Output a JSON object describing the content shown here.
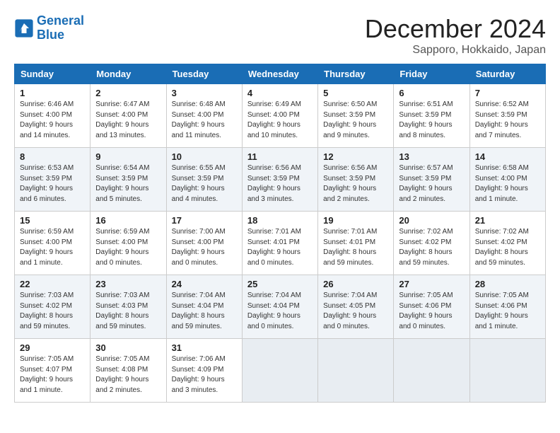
{
  "logo": {
    "line1": "General",
    "line2": "Blue"
  },
  "title": "December 2024",
  "location": "Sapporo, Hokkaido, Japan",
  "headers": [
    "Sunday",
    "Monday",
    "Tuesday",
    "Wednesday",
    "Thursday",
    "Friday",
    "Saturday"
  ],
  "weeks": [
    [
      {
        "day": "1",
        "info": "Sunrise: 6:46 AM\nSunset: 4:00 PM\nDaylight: 9 hours\nand 14 minutes."
      },
      {
        "day": "2",
        "info": "Sunrise: 6:47 AM\nSunset: 4:00 PM\nDaylight: 9 hours\nand 13 minutes."
      },
      {
        "day": "3",
        "info": "Sunrise: 6:48 AM\nSunset: 4:00 PM\nDaylight: 9 hours\nand 11 minutes."
      },
      {
        "day": "4",
        "info": "Sunrise: 6:49 AM\nSunset: 4:00 PM\nDaylight: 9 hours\nand 10 minutes."
      },
      {
        "day": "5",
        "info": "Sunrise: 6:50 AM\nSunset: 3:59 PM\nDaylight: 9 hours\nand 9 minutes."
      },
      {
        "day": "6",
        "info": "Sunrise: 6:51 AM\nSunset: 3:59 PM\nDaylight: 9 hours\nand 8 minutes."
      },
      {
        "day": "7",
        "info": "Sunrise: 6:52 AM\nSunset: 3:59 PM\nDaylight: 9 hours\nand 7 minutes."
      }
    ],
    [
      {
        "day": "8",
        "info": "Sunrise: 6:53 AM\nSunset: 3:59 PM\nDaylight: 9 hours\nand 6 minutes."
      },
      {
        "day": "9",
        "info": "Sunrise: 6:54 AM\nSunset: 3:59 PM\nDaylight: 9 hours\nand 5 minutes."
      },
      {
        "day": "10",
        "info": "Sunrise: 6:55 AM\nSunset: 3:59 PM\nDaylight: 9 hours\nand 4 minutes."
      },
      {
        "day": "11",
        "info": "Sunrise: 6:56 AM\nSunset: 3:59 PM\nDaylight: 9 hours\nand 3 minutes."
      },
      {
        "day": "12",
        "info": "Sunrise: 6:56 AM\nSunset: 3:59 PM\nDaylight: 9 hours\nand 2 minutes."
      },
      {
        "day": "13",
        "info": "Sunrise: 6:57 AM\nSunset: 3:59 PM\nDaylight: 9 hours\nand 2 minutes."
      },
      {
        "day": "14",
        "info": "Sunrise: 6:58 AM\nSunset: 4:00 PM\nDaylight: 9 hours\nand 1 minute."
      }
    ],
    [
      {
        "day": "15",
        "info": "Sunrise: 6:59 AM\nSunset: 4:00 PM\nDaylight: 9 hours\nand 1 minute."
      },
      {
        "day": "16",
        "info": "Sunrise: 6:59 AM\nSunset: 4:00 PM\nDaylight: 9 hours\nand 0 minutes."
      },
      {
        "day": "17",
        "info": "Sunrise: 7:00 AM\nSunset: 4:00 PM\nDaylight: 9 hours\nand 0 minutes."
      },
      {
        "day": "18",
        "info": "Sunrise: 7:01 AM\nSunset: 4:01 PM\nDaylight: 9 hours\nand 0 minutes."
      },
      {
        "day": "19",
        "info": "Sunrise: 7:01 AM\nSunset: 4:01 PM\nDaylight: 8 hours\nand 59 minutes."
      },
      {
        "day": "20",
        "info": "Sunrise: 7:02 AM\nSunset: 4:02 PM\nDaylight: 8 hours\nand 59 minutes."
      },
      {
        "day": "21",
        "info": "Sunrise: 7:02 AM\nSunset: 4:02 PM\nDaylight: 8 hours\nand 59 minutes."
      }
    ],
    [
      {
        "day": "22",
        "info": "Sunrise: 7:03 AM\nSunset: 4:02 PM\nDaylight: 8 hours\nand 59 minutes."
      },
      {
        "day": "23",
        "info": "Sunrise: 7:03 AM\nSunset: 4:03 PM\nDaylight: 8 hours\nand 59 minutes."
      },
      {
        "day": "24",
        "info": "Sunrise: 7:04 AM\nSunset: 4:04 PM\nDaylight: 8 hours\nand 59 minutes."
      },
      {
        "day": "25",
        "info": "Sunrise: 7:04 AM\nSunset: 4:04 PM\nDaylight: 9 hours\nand 0 minutes."
      },
      {
        "day": "26",
        "info": "Sunrise: 7:04 AM\nSunset: 4:05 PM\nDaylight: 9 hours\nand 0 minutes."
      },
      {
        "day": "27",
        "info": "Sunrise: 7:05 AM\nSunset: 4:06 PM\nDaylight: 9 hours\nand 0 minutes."
      },
      {
        "day": "28",
        "info": "Sunrise: 7:05 AM\nSunset: 4:06 PM\nDaylight: 9 hours\nand 1 minute."
      }
    ],
    [
      {
        "day": "29",
        "info": "Sunrise: 7:05 AM\nSunset: 4:07 PM\nDaylight: 9 hours\nand 1 minute."
      },
      {
        "day": "30",
        "info": "Sunrise: 7:05 AM\nSunset: 4:08 PM\nDaylight: 9 hours\nand 2 minutes."
      },
      {
        "day": "31",
        "info": "Sunrise: 7:06 AM\nSunset: 4:09 PM\nDaylight: 9 hours\nand 3 minutes."
      },
      {
        "day": "",
        "info": ""
      },
      {
        "day": "",
        "info": ""
      },
      {
        "day": "",
        "info": ""
      },
      {
        "day": "",
        "info": ""
      }
    ]
  ]
}
